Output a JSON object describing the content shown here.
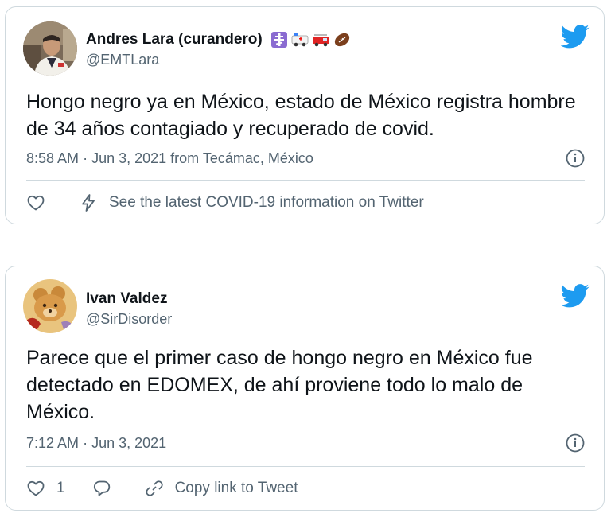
{
  "tweets": [
    {
      "author_name": "Andres Lara (curandero)",
      "author_emojis": [
        "orthodox-cross-icon",
        "ambulance-icon",
        "fire-engine-icon",
        "football-icon"
      ],
      "handle": "@EMTLara",
      "text": "Hongo negro ya en México, estado de México registra hombre de 34 años contagiado y recuperado de covid.",
      "time": "8:58 AM",
      "date": "Jun 3, 2021",
      "source": "from Tecámac, México",
      "covid_banner": "See the latest COVID-19 information on Twitter"
    },
    {
      "author_name": "Ivan Valdez",
      "handle": "@SirDisorder",
      "text": "Parece que el primer caso de hongo negro en México fue detectado en EDOMEX, de ahí proviene todo lo malo de México.",
      "time": "7:12 AM",
      "date": "Jun 3, 2021",
      "like_count": "1",
      "copy_link_label": "Copy link to Tweet"
    }
  ],
  "separator": "·",
  "colors": {
    "twitter_blue": "#1d9bf0",
    "secondary_text": "#536471",
    "border": "#cfd9de",
    "primary_text": "#0f1419"
  }
}
